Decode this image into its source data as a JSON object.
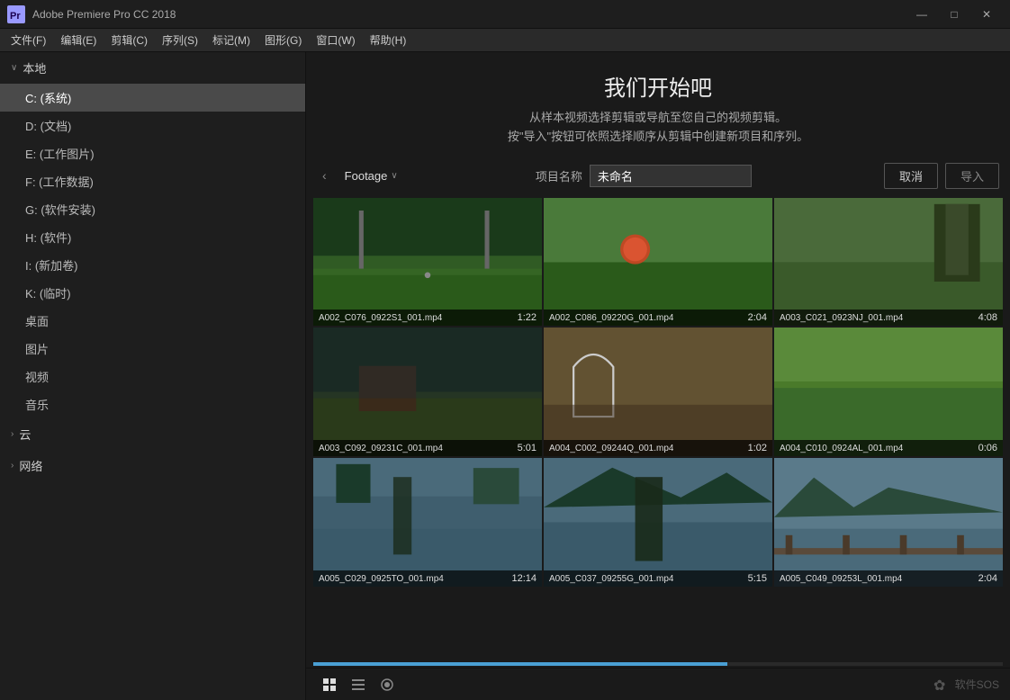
{
  "app": {
    "logo_text": "Pr",
    "title": "Adobe Premiere Pro CC 2018",
    "window_controls": {
      "minimize": "—",
      "maximize": "□",
      "close": "✕"
    }
  },
  "menubar": {
    "items": [
      {
        "label": "文件(F)"
      },
      {
        "label": "编辑(E)"
      },
      {
        "label": "剪辑(C)"
      },
      {
        "label": "序列(S)"
      },
      {
        "label": "标记(M)"
      },
      {
        "label": "图形(G)"
      },
      {
        "label": "窗口(W)"
      },
      {
        "label": "帮助(H)"
      }
    ]
  },
  "sidebar": {
    "local_label": "本地",
    "items": [
      {
        "label": "C: (系统)",
        "active": true
      },
      {
        "label": "D: (文档)"
      },
      {
        "label": "E: (工作图片)"
      },
      {
        "label": "F: (工作数据)"
      },
      {
        "label": "G: (软件安装)"
      },
      {
        "label": "H: (软件)"
      },
      {
        "label": "I: (新加卷)"
      },
      {
        "label": "K: (临时)"
      },
      {
        "label": "桌面"
      },
      {
        "label": "图片"
      },
      {
        "label": "视频"
      },
      {
        "label": "音乐"
      }
    ],
    "cloud_label": "云",
    "network_label": "网络"
  },
  "welcome": {
    "title": "我们开始吧",
    "desc_line1": "从样本视频选择剪辑或导航至您自己的视频剪辑。",
    "desc_line2": "按\"导入\"按钮可依照选择顺序从剪辑中创建新项目和序列。"
  },
  "toolbar": {
    "back_icon": "‹",
    "folder_name": "Footage",
    "folder_chevron": "∨",
    "project_label": "项目名称",
    "project_name_value": "未命名",
    "cancel_label": "取消",
    "import_label": "导入"
  },
  "videos": [
    {
      "filename": "A002_C076_0922S1_001.mp4",
      "duration": "1:22",
      "thumb_class": "thumb-1"
    },
    {
      "filename": "A002_C086_09220G_001.mp4",
      "duration": "2:04",
      "thumb_class": "thumb-2"
    },
    {
      "filename": "A003_C021_0923NJ_001.mp4",
      "duration": "4:08",
      "thumb_class": "thumb-3"
    },
    {
      "filename": "A003_C092_09231C_001.mp4",
      "duration": "5:01",
      "thumb_class": "thumb-4"
    },
    {
      "filename": "A004_C002_09244Q_001.mp4",
      "duration": "1:02",
      "thumb_class": "thumb-5"
    },
    {
      "filename": "A004_C010_0924AL_001.mp4",
      "duration": "0:06",
      "thumb_class": "thumb-6"
    },
    {
      "filename": "A005_C029_0925TO_001.mp4",
      "duration": "12:14",
      "thumb_class": "thumb-7"
    },
    {
      "filename": "A005_C037_09255G_001.mp4",
      "duration": "5:15",
      "thumb_class": "thumb-8"
    },
    {
      "filename": "A005_C049_09253L_001.mp4",
      "duration": "2:04",
      "thumb_class": "thumb-9"
    }
  ],
  "bottom": {
    "grid_view_icon": "⊞",
    "list_view_icon": "≡",
    "preview_icon": "◉",
    "watermark": "软件SOS"
  }
}
